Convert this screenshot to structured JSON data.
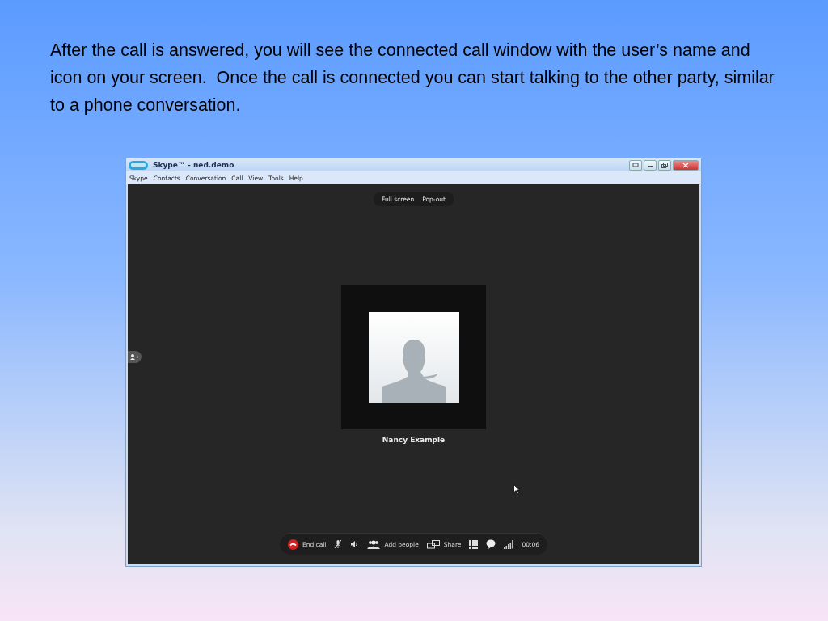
{
  "slide": {
    "text": "After the call is answered, you will see the connected call window with the user’s name and icon on your screen.  Once the call is connected you can start talking to the other party, similar to a phone conversation."
  },
  "window": {
    "title": "Skype™ - ned.demo"
  },
  "menu": [
    "Skype",
    "Contacts",
    "Conversation",
    "Call",
    "View",
    "Tools",
    "Help"
  ],
  "view_buttons": [
    "Full screen",
    "Pop-out"
  ],
  "contact": {
    "name": "Nancy Example"
  },
  "call_toolbar": [
    {
      "kind": "end",
      "label": "End call"
    },
    {
      "kind": "mic"
    },
    {
      "kind": "speaker"
    },
    {
      "kind": "add",
      "label": "Add people"
    },
    {
      "kind": "share",
      "label": "Share"
    },
    {
      "kind": "dialpad"
    },
    {
      "kind": "chat"
    },
    {
      "kind": "signal"
    },
    {
      "kind": "timer",
      "label": "00:06"
    }
  ]
}
